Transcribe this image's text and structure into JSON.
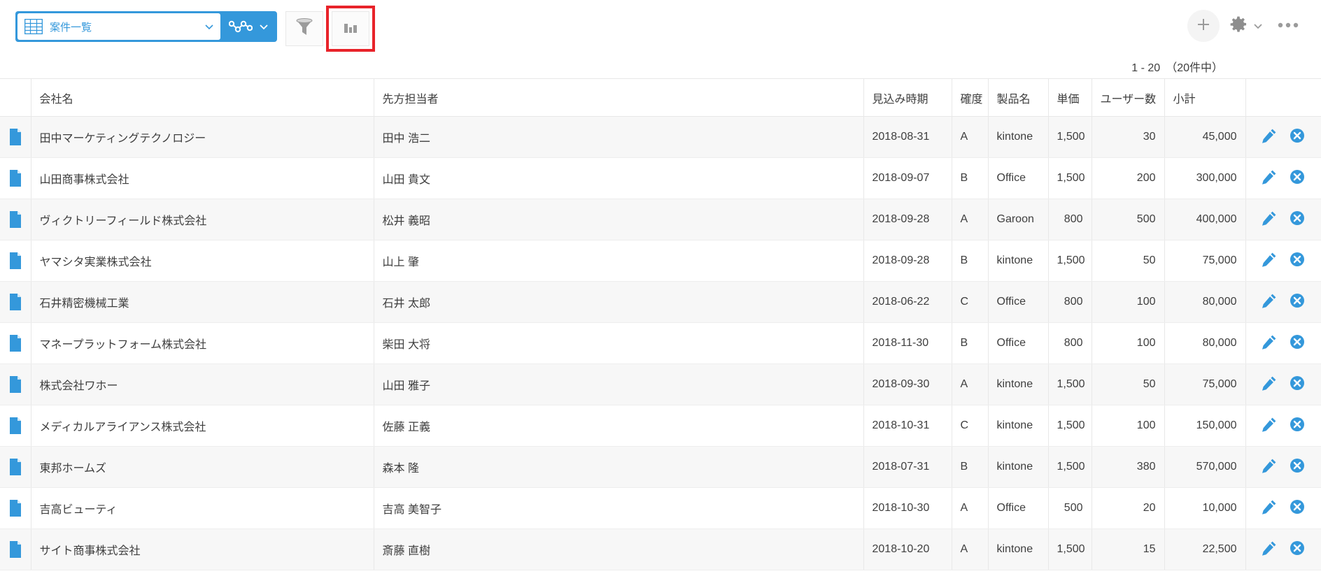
{
  "toolbar": {
    "view_name": "案件一覧",
    "grid_icon": "grid-icon",
    "view_dropdown_icon": "chevron-down-icon",
    "graph_icon": "graph-icon",
    "graph_dropdown_icon": "chevron-down-icon",
    "filter_icon": "funnel-icon",
    "chart_icon": "bar-chart-icon",
    "add_icon": "plus-icon",
    "settings_icon": "gear-icon",
    "settings_dropdown_icon": "chevron-down-icon",
    "more_icon": "ellipsis-icon",
    "highlight_color": "#e8232a",
    "accent_color": "#3498db"
  },
  "pager": {
    "text": "1 - 20　（20件中）"
  },
  "table": {
    "columns": [
      {
        "key": "mark",
        "label": ""
      },
      {
        "key": "company",
        "label": "会社名"
      },
      {
        "key": "person",
        "label": "先方担当者"
      },
      {
        "key": "date",
        "label": "見込み時期"
      },
      {
        "key": "prob",
        "label": "確度"
      },
      {
        "key": "product",
        "label": "製品名"
      },
      {
        "key": "price",
        "label": "単価"
      },
      {
        "key": "users",
        "label": "ユーザー数"
      },
      {
        "key": "sub",
        "label": "小計"
      },
      {
        "key": "actions",
        "label": ""
      }
    ],
    "row_icon": "document-icon",
    "edit_icon": "pencil-icon",
    "delete_icon": "delete-circle-icon",
    "rows": [
      {
        "company": "田中マーケティングテクノロジー",
        "person": "田中 浩二",
        "date": "2018-08-31",
        "prob": "A",
        "product": "kintone",
        "price": "1,500",
        "users": "30",
        "sub": "45,000"
      },
      {
        "company": "山田商事株式会社",
        "person": "山田 貴文",
        "date": "2018-09-07",
        "prob": "B",
        "product": "Office",
        "price": "1,500",
        "users": "200",
        "sub": "300,000"
      },
      {
        "company": "ヴィクトリーフィールド株式会社",
        "person": "松井 義昭",
        "date": "2018-09-28",
        "prob": "A",
        "product": "Garoon",
        "price": "800",
        "users": "500",
        "sub": "400,000"
      },
      {
        "company": "ヤマシタ実業株式会社",
        "person": "山上 肇",
        "date": "2018-09-28",
        "prob": "B",
        "product": "kintone",
        "price": "1,500",
        "users": "50",
        "sub": "75,000"
      },
      {
        "company": "石井精密機械工業",
        "person": "石井 太郎",
        "date": "2018-06-22",
        "prob": "C",
        "product": "Office",
        "price": "800",
        "users": "100",
        "sub": "80,000"
      },
      {
        "company": "マネープラットフォーム株式会社",
        "person": "柴田 大将",
        "date": "2018-11-30",
        "prob": "B",
        "product": "Office",
        "price": "800",
        "users": "100",
        "sub": "80,000"
      },
      {
        "company": "株式会社ワホー",
        "person": "山田 雅子",
        "date": "2018-09-30",
        "prob": "A",
        "product": "kintone",
        "price": "1,500",
        "users": "50",
        "sub": "75,000"
      },
      {
        "company": "メディカルアライアンス株式会社",
        "person": "佐藤 正義",
        "date": "2018-10-31",
        "prob": "C",
        "product": "kintone",
        "price": "1,500",
        "users": "100",
        "sub": "150,000"
      },
      {
        "company": "東邦ホームズ",
        "person": "森本 隆",
        "date": "2018-07-31",
        "prob": "B",
        "product": "kintone",
        "price": "1,500",
        "users": "380",
        "sub": "570,000"
      },
      {
        "company": "吉高ビューティ",
        "person": "吉高 美智子",
        "date": "2018-10-30",
        "prob": "A",
        "product": "Office",
        "price": "500",
        "users": "20",
        "sub": "10,000"
      },
      {
        "company": "サイト商事株式会社",
        "person": "斎藤 直樹",
        "date": "2018-10-20",
        "prob": "A",
        "product": "kintone",
        "price": "1,500",
        "users": "15",
        "sub": "22,500"
      }
    ]
  }
}
